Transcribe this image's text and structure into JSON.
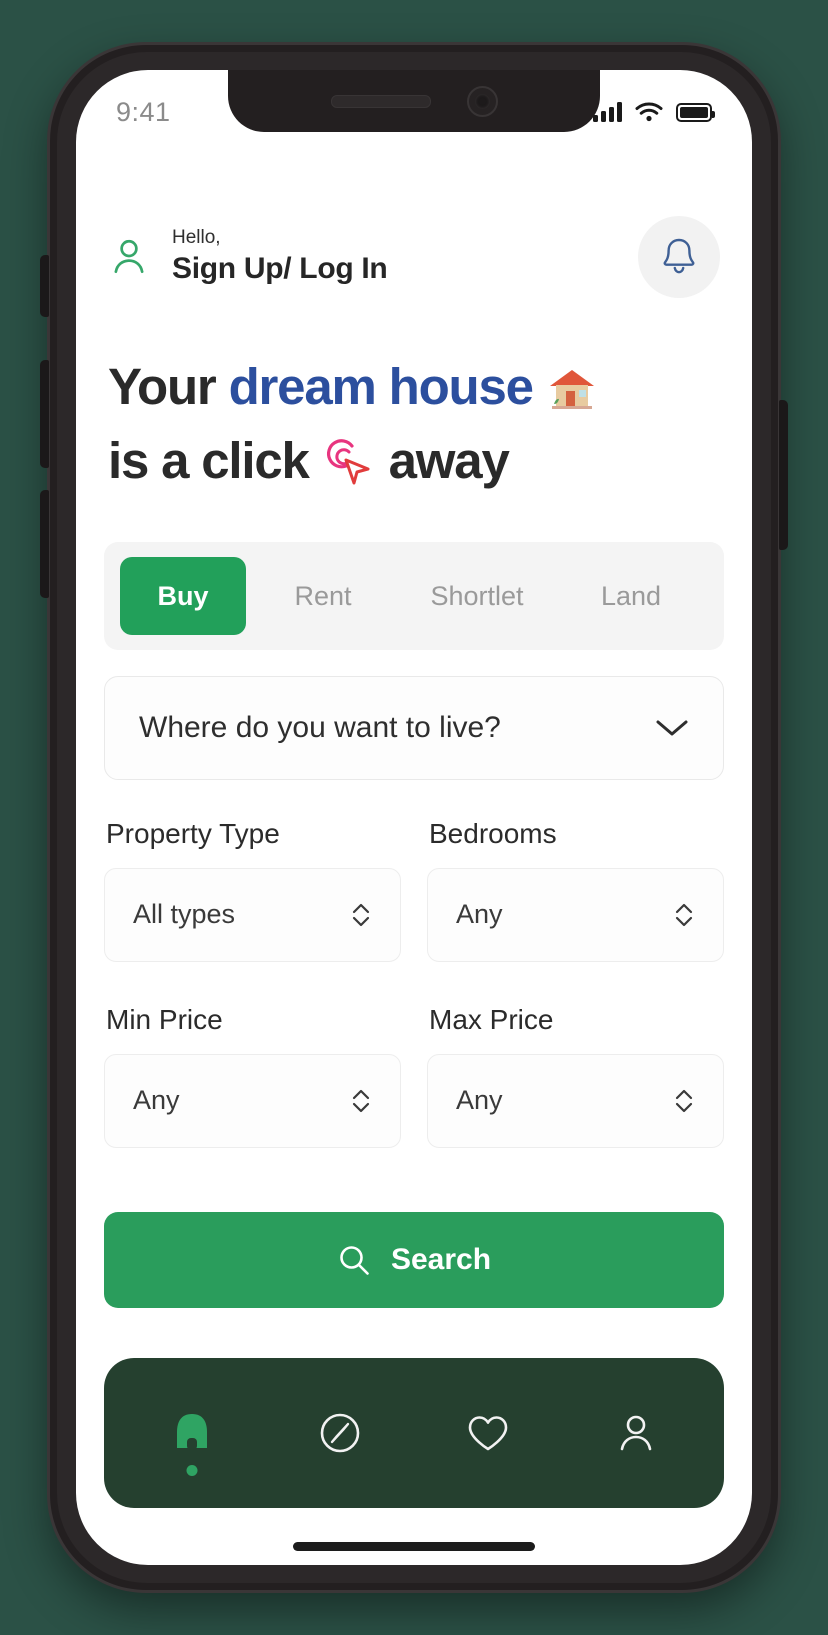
{
  "status_bar": {
    "time": "9:41",
    "signal_icon": "cellular-signal-icon",
    "wifi_icon": "wifi-icon",
    "battery_icon": "battery-full-icon"
  },
  "header": {
    "user_icon": "user-outline-icon",
    "greeting_small": "Hello,",
    "greeting_action": "Sign Up/ Log In",
    "notification_icon": "bell-icon"
  },
  "hero": {
    "line1_plain": "Your",
    "line1_accent": "dream house",
    "line1_emoji": "house-emoji",
    "line2_plain": "is a click",
    "line2_emoji": "click-cursor-emoji",
    "line2_tail": "away",
    "accent_color": "#2c4f9e",
    "text_color": "#2a2a2a"
  },
  "tabs": {
    "items": [
      {
        "label": "Buy",
        "active": true
      },
      {
        "label": "Rent",
        "active": false
      },
      {
        "label": "Shortlet",
        "active": false
      },
      {
        "label": "Land",
        "active": false
      }
    ],
    "active_bg": "#22a05a",
    "track_bg": "#f4f4f4"
  },
  "location": {
    "value": "Where do you want to live?",
    "chevron_icon": "chevron-down-icon"
  },
  "filters": [
    {
      "label": "Property Type",
      "value": "All types",
      "icon": "chevron-up-down-icon"
    },
    {
      "label": "Bedrooms",
      "value": "Any",
      "icon": "chevron-up-down-icon"
    },
    {
      "label": "Min Price",
      "value": "Any",
      "icon": "chevron-up-down-icon"
    },
    {
      "label": "Max Price",
      "value": "Any",
      "icon": "chevron-up-down-icon"
    }
  ],
  "search": {
    "label": "Search",
    "icon": "search-icon",
    "bg_color": "#2a9d5c"
  },
  "bottom_nav": {
    "bg_color": "#25402f",
    "active_color": "#2fa463",
    "items": [
      {
        "icon": "home-icon",
        "active": true
      },
      {
        "icon": "compass-icon",
        "active": false
      },
      {
        "icon": "heart-icon",
        "active": false
      },
      {
        "icon": "profile-icon",
        "active": false
      }
    ]
  }
}
